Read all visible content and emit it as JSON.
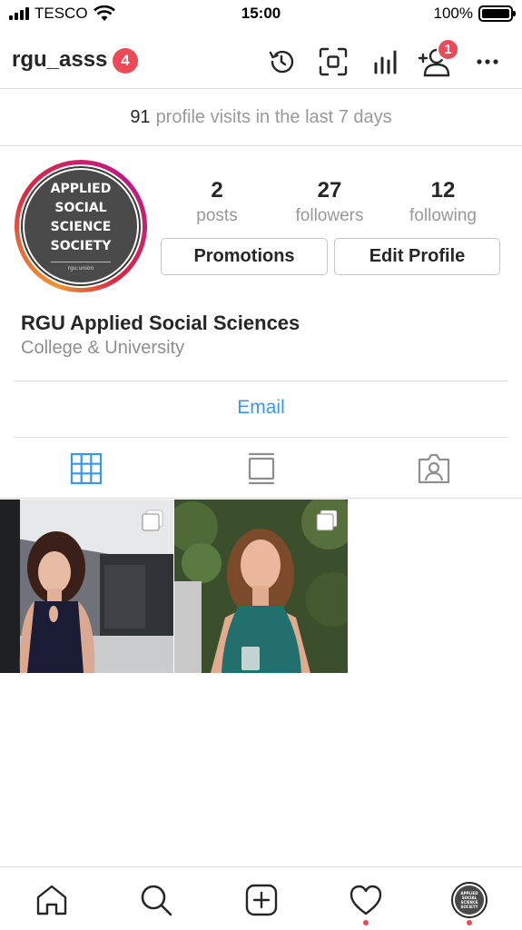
{
  "status_bar": {
    "carrier": "TESCO",
    "time": "15:00",
    "battery": "100%",
    "battery_level": 1.0
  },
  "header": {
    "username": "rgu_asss",
    "notification_count": "4",
    "follow_request_count": "1",
    "icons": [
      "history-icon",
      "qr-scan-icon",
      "insights-icon",
      "add-person-icon",
      "more-options-icon"
    ]
  },
  "profile_visits": {
    "count": "91",
    "text": "profile visits in the last 7 days"
  },
  "avatar": {
    "lines": [
      "APPLIED",
      "SOCIAL",
      "SCIENCE",
      "SOCIETY"
    ],
    "footer": "rgu:union"
  },
  "stats": [
    {
      "value": "2",
      "label": "posts"
    },
    {
      "value": "27",
      "label": "followers"
    },
    {
      "value": "12",
      "label": "following"
    }
  ],
  "buttons": {
    "promotions": "Promotions",
    "edit_profile": "Edit Profile"
  },
  "bio": {
    "name": "RGU Applied Social Sciences",
    "category": "College & University"
  },
  "contact": {
    "email_label": "Email"
  },
  "tabs": [
    {
      "name": "grid",
      "active": true
    },
    {
      "name": "igtv",
      "active": false
    },
    {
      "name": "tagged",
      "active": false
    }
  ],
  "posts": [
    {
      "type": "carousel",
      "icon": "carousel-icon"
    },
    {
      "type": "carousel",
      "icon": "carousel-icon"
    }
  ],
  "bottom_nav": [
    "home-icon",
    "search-icon",
    "new-post-icon",
    "activity-heart-icon",
    "profile-avatar"
  ],
  "colors": {
    "accent_blue": "#3897f0",
    "badge_red": "#ed4956",
    "text_dark": "#262626",
    "text_gray": "#999999",
    "border": "#dbdbdb"
  }
}
